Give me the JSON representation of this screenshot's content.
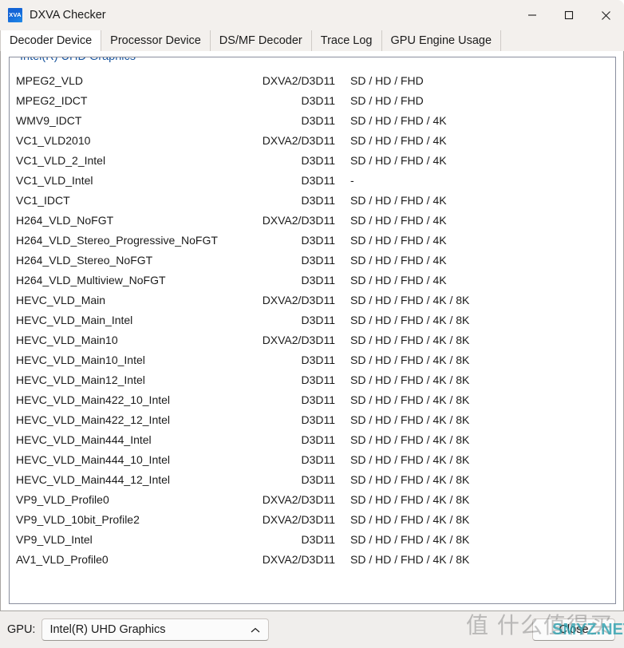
{
  "window": {
    "title": "DXVA Checker",
    "icon_label": "XVA",
    "controls": {
      "minimize": "minimize-button",
      "maximize": "maximize-button",
      "close": "close-window-button"
    }
  },
  "tabs": [
    {
      "label": "Decoder Device",
      "active": true
    },
    {
      "label": "Processor Device",
      "active": false
    },
    {
      "label": "DS/MF Decoder",
      "active": false
    },
    {
      "label": "Trace Log",
      "active": false
    },
    {
      "label": "GPU Engine Usage",
      "active": false
    }
  ],
  "group": {
    "legend": "Intel(R) UHD Graphics"
  },
  "table": {
    "rows": [
      {
        "name": "MPEG2_VLD",
        "api": "DXVA2/D3D11",
        "res": "SD / HD / FHD"
      },
      {
        "name": "MPEG2_IDCT",
        "api": "D3D11",
        "res": "SD / HD / FHD"
      },
      {
        "name": "WMV9_IDCT",
        "api": "D3D11",
        "res": "SD / HD / FHD / 4K"
      },
      {
        "name": "VC1_VLD2010",
        "api": "DXVA2/D3D11",
        "res": "SD / HD / FHD / 4K"
      },
      {
        "name": "VC1_VLD_2_Intel",
        "api": "D3D11",
        "res": "SD / HD / FHD / 4K"
      },
      {
        "name": "VC1_VLD_Intel",
        "api": "D3D11",
        "res": "-"
      },
      {
        "name": "VC1_IDCT",
        "api": "D3D11",
        "res": "SD / HD / FHD / 4K"
      },
      {
        "name": "H264_VLD_NoFGT",
        "api": "DXVA2/D3D11",
        "res": "SD / HD / FHD / 4K"
      },
      {
        "name": "H264_VLD_Stereo_Progressive_NoFGT",
        "api": "D3D11",
        "res": "SD / HD / FHD / 4K"
      },
      {
        "name": "H264_VLD_Stereo_NoFGT",
        "api": "D3D11",
        "res": "SD / HD / FHD / 4K"
      },
      {
        "name": "H264_VLD_Multiview_NoFGT",
        "api": "D3D11",
        "res": "SD / HD / FHD / 4K"
      },
      {
        "name": "HEVC_VLD_Main",
        "api": "DXVA2/D3D11",
        "res": "SD / HD / FHD / 4K / 8K"
      },
      {
        "name": "HEVC_VLD_Main_Intel",
        "api": "D3D11",
        "res": "SD / HD / FHD / 4K / 8K"
      },
      {
        "name": "HEVC_VLD_Main10",
        "api": "DXVA2/D3D11",
        "res": "SD / HD / FHD / 4K / 8K"
      },
      {
        "name": "HEVC_VLD_Main10_Intel",
        "api": "D3D11",
        "res": "SD / HD / FHD / 4K / 8K"
      },
      {
        "name": "HEVC_VLD_Main12_Intel",
        "api": "D3D11",
        "res": "SD / HD / FHD / 4K / 8K"
      },
      {
        "name": "HEVC_VLD_Main422_10_Intel",
        "api": "D3D11",
        "res": "SD / HD / FHD / 4K / 8K"
      },
      {
        "name": "HEVC_VLD_Main422_12_Intel",
        "api": "D3D11",
        "res": "SD / HD / FHD / 4K / 8K"
      },
      {
        "name": "HEVC_VLD_Main444_Intel",
        "api": "D3D11",
        "res": "SD / HD / FHD / 4K / 8K"
      },
      {
        "name": "HEVC_VLD_Main444_10_Intel",
        "api": "D3D11",
        "res": "SD / HD / FHD / 4K / 8K"
      },
      {
        "name": "HEVC_VLD_Main444_12_Intel",
        "api": "D3D11",
        "res": "SD / HD / FHD / 4K / 8K"
      },
      {
        "name": "VP9_VLD_Profile0",
        "api": "DXVA2/D3D11",
        "res": "SD / HD / FHD / 4K / 8K"
      },
      {
        "name": "VP9_VLD_10bit_Profile2",
        "api": "DXVA2/D3D11",
        "res": "SD / HD / FHD / 4K / 8K"
      },
      {
        "name": "VP9_VLD_Intel",
        "api": "D3D11",
        "res": "SD / HD / FHD / 4K / 8K"
      },
      {
        "name": "AV1_VLD_Profile0",
        "api": "DXVA2/D3D11",
        "res": "SD / HD / FHD / 4K / 8K"
      }
    ]
  },
  "bottom": {
    "gpu_label": "GPU:",
    "gpu_value": "Intel(R) UHD Graphics",
    "close_label": "Close"
  },
  "watermark": {
    "cn": "值 什么值得买",
    "en": "SMYZ.NET"
  },
  "colors": {
    "legend": "#19559e",
    "watermark_teal": "#2aa0af",
    "icon_blue": "#1464d6"
  }
}
